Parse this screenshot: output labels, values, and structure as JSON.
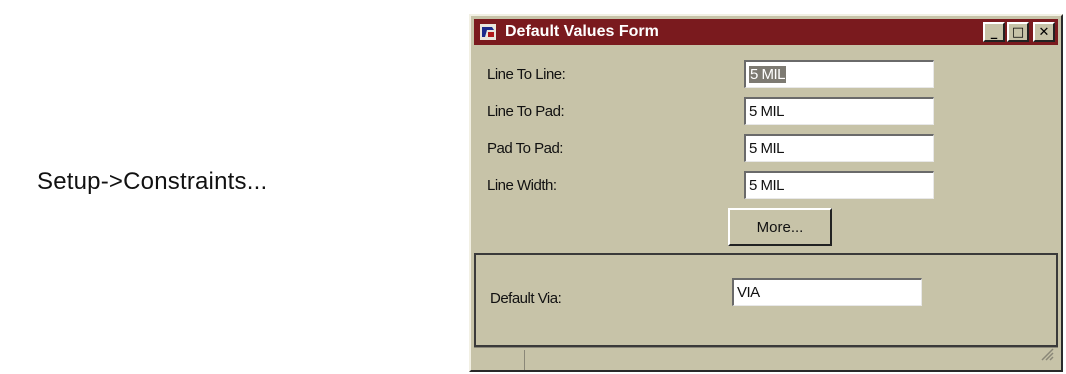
{
  "caption": "Setup->Constraints...",
  "window": {
    "title": "Default Values Form",
    "controls": {
      "minimize": "_",
      "maximize": "□",
      "close": "✕"
    }
  },
  "fields": [
    {
      "label": "Line To Line:",
      "value": "5 MIL"
    },
    {
      "label": "Line To Pad:",
      "value": "5 MIL"
    },
    {
      "label": "Pad To Pad:",
      "value": "5 MIL"
    },
    {
      "label": "Line Width:",
      "value": "5 MIL"
    }
  ],
  "more_button": "More...",
  "via": {
    "label": "Default Via:",
    "value": "VIA"
  },
  "colors": {
    "titlebar": "#7a1a1e",
    "face": "#c7c3a8"
  }
}
